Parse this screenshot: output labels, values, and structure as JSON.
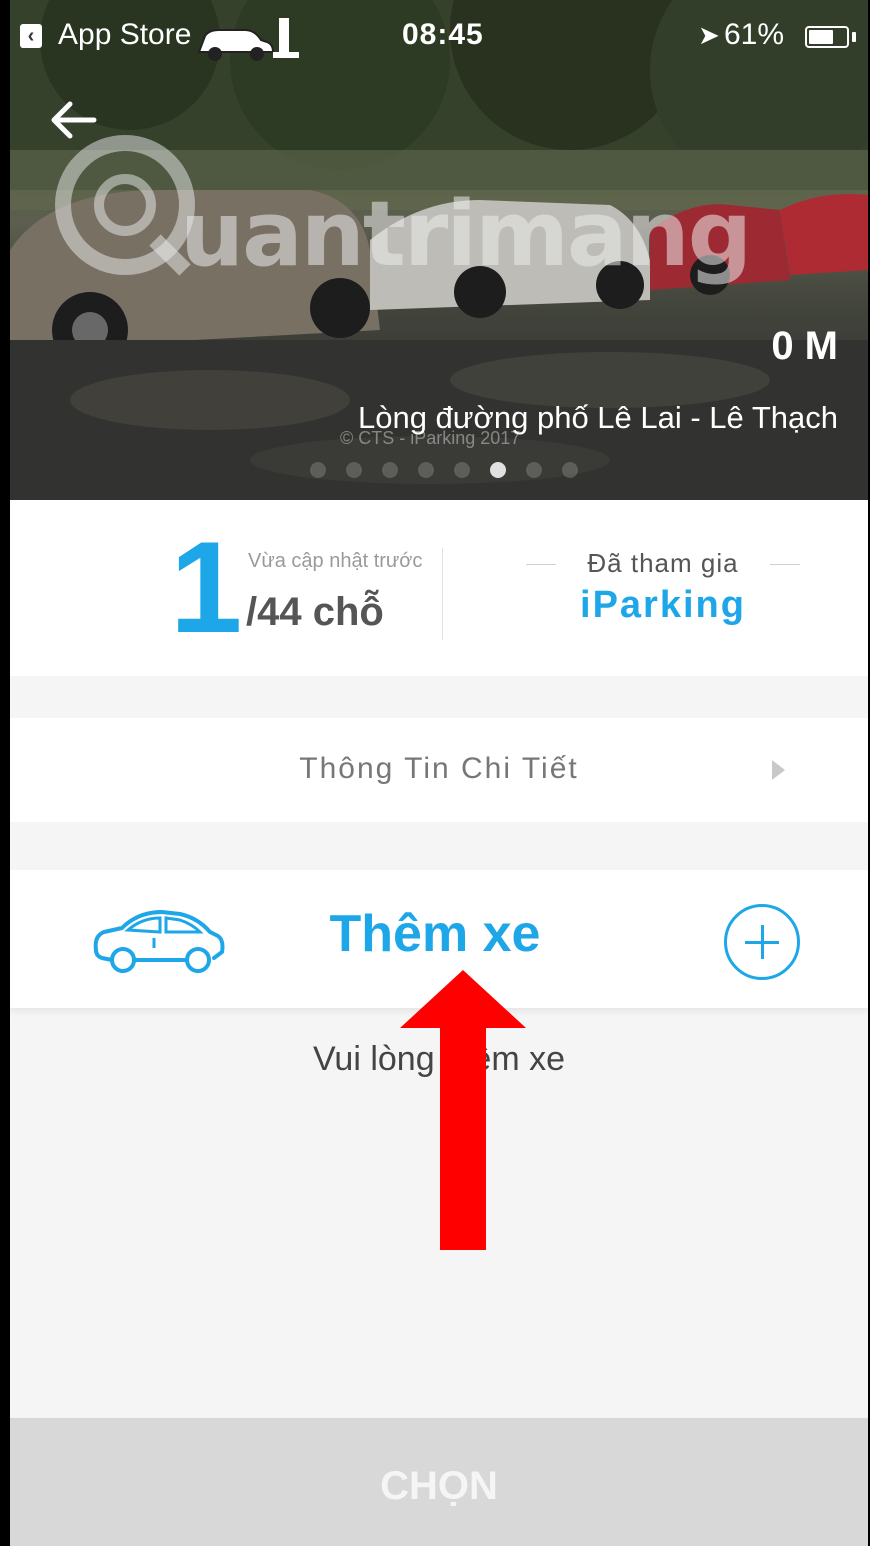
{
  "status_bar": {
    "back_to": "App Store",
    "time": "08:45",
    "battery": "61%"
  },
  "hero": {
    "watermark_text": "uantrimang",
    "copyright": "© CTS - iParking 2017",
    "distance": "0 M",
    "address": "Lòng đường phố Lê Lai - Lê Thạch",
    "carousel": {
      "total": 8,
      "active_index": 6
    }
  },
  "info": {
    "available": "1",
    "updated_label": "Vừa cập nhật trước",
    "slots": "/44 chỗ",
    "joined_label": "Đã tham gia",
    "brand": "iParking"
  },
  "details": {
    "label": "Thông Tin Chi Tiết"
  },
  "add_car": {
    "label": "Thêm xe"
  },
  "empty_message": "Vui lòng thêm xe",
  "choose_button": {
    "label": "CHỌN"
  },
  "colors": {
    "accent": "#1ea7e8",
    "arrow": "#ff0000",
    "button_disabled": "#d8d8d8"
  }
}
